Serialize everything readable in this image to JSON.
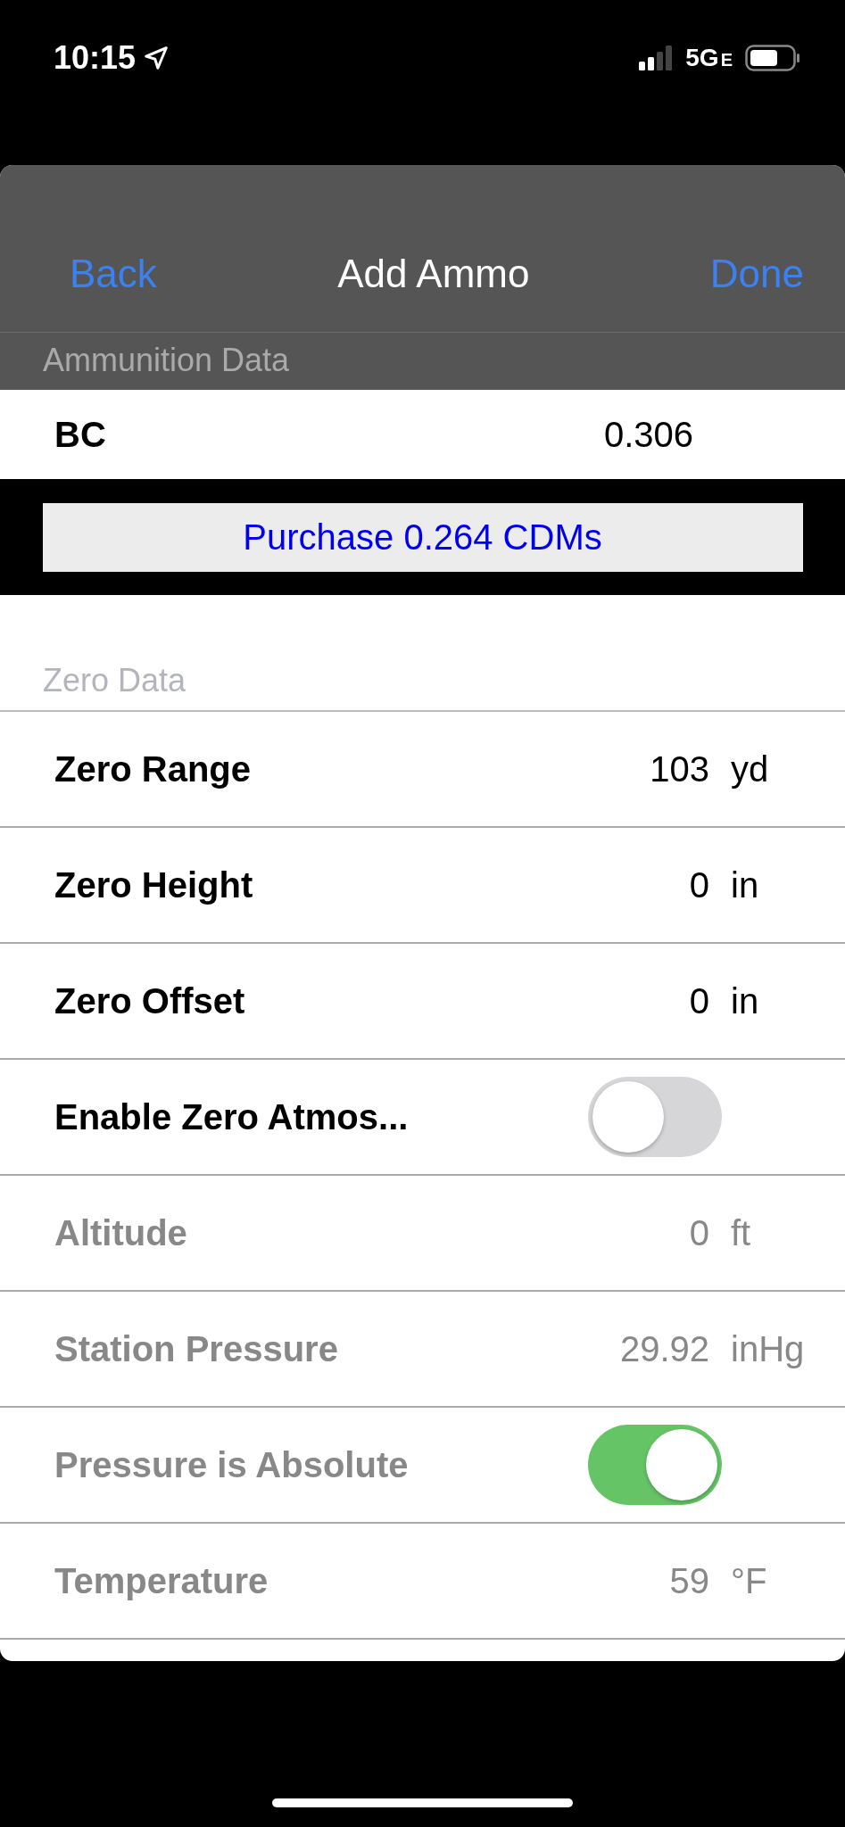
{
  "status_bar": {
    "time": "10:15",
    "network": "5G",
    "network_sub": "E"
  },
  "nav": {
    "back": "Back",
    "title": "Add Ammo",
    "done": "Done"
  },
  "sections": [
    {
      "header": "Ammunition Data",
      "rows": [
        {
          "kind": "value",
          "label": "BC",
          "value": "0.306",
          "disabled": false
        }
      ]
    },
    {
      "header": "Zero Data",
      "rows": [
        {
          "kind": "value",
          "label": "Zero Range",
          "value": "103",
          "unit": "yd",
          "disabled": false
        },
        {
          "kind": "value",
          "label": "Zero Height",
          "value": "0",
          "unit": "in",
          "disabled": false
        },
        {
          "kind": "value",
          "label": "Zero Offset",
          "value": "0",
          "unit": "in",
          "disabled": false
        },
        {
          "kind": "toggle",
          "label": "Enable Zero Atmos...",
          "on": false,
          "disabled": false
        },
        {
          "kind": "value",
          "label": "Altitude",
          "value": "0",
          "unit": "ft",
          "disabled": true
        },
        {
          "kind": "value",
          "label": "Station Pressure",
          "value": "29.92",
          "unit": "inHg",
          "disabled": true
        },
        {
          "kind": "toggle",
          "label": "Pressure is Absolute",
          "on": true,
          "disabled": true
        },
        {
          "kind": "value",
          "label": "Temperature",
          "value": "59",
          "unit": "°F",
          "disabled": true
        }
      ]
    }
  ],
  "purchase_button": "Purchase 0.264 CDMs"
}
